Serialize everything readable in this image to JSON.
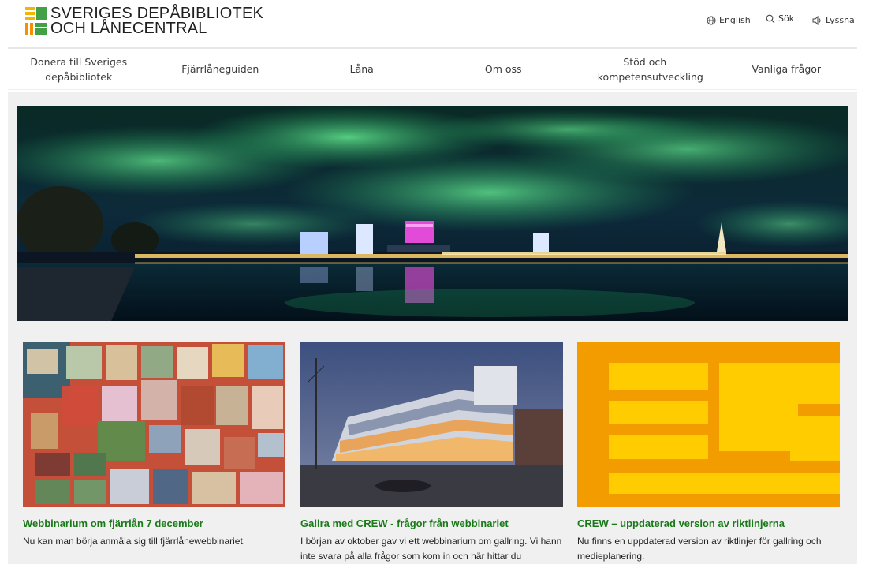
{
  "header": {
    "logo_line1": "SVERIGES DEPÅBIBLIOTEK",
    "logo_line2": "OCH LÅNECENTRAL",
    "logo_colors": [
      "#e8b400",
      "#f39200",
      "#4caf50",
      "#2e7d32"
    ],
    "utils": {
      "english": "English",
      "search": "Sök",
      "listen": "Lyssna"
    }
  },
  "nav": {
    "items": [
      {
        "label": "Donera till Sveriges depåbibliotek"
      },
      {
        "label": "Fjärrlåneguiden"
      },
      {
        "label": "Låna"
      },
      {
        "label": "Om oss"
      },
      {
        "label": "Stöd och kompetensutveckling"
      },
      {
        "label": "Vanliga frågor"
      }
    ]
  },
  "cards": [
    {
      "title": "Webbinarium om fjärrlån 7 december",
      "text": "Nu kan man börja anmäla sig till fjärrlånewebbinariet."
    },
    {
      "title": "Gallra med CREW - frågor från webbinariet",
      "text": "I början av oktober gav vi ett webbinarium om gallring. Vi hann inte svara på alla frågor som kom in och här hittar du"
    },
    {
      "title": "CREW – uppdaterad version av riktlinjerna",
      "text": "Nu finns en uppdaterad version av riktlinjer för gallring och medieplanering."
    }
  ],
  "colors": {
    "accent_green": "#1a7a1a",
    "crew_orange": "#f39c00",
    "crew_yellow": "#ffcc00"
  }
}
